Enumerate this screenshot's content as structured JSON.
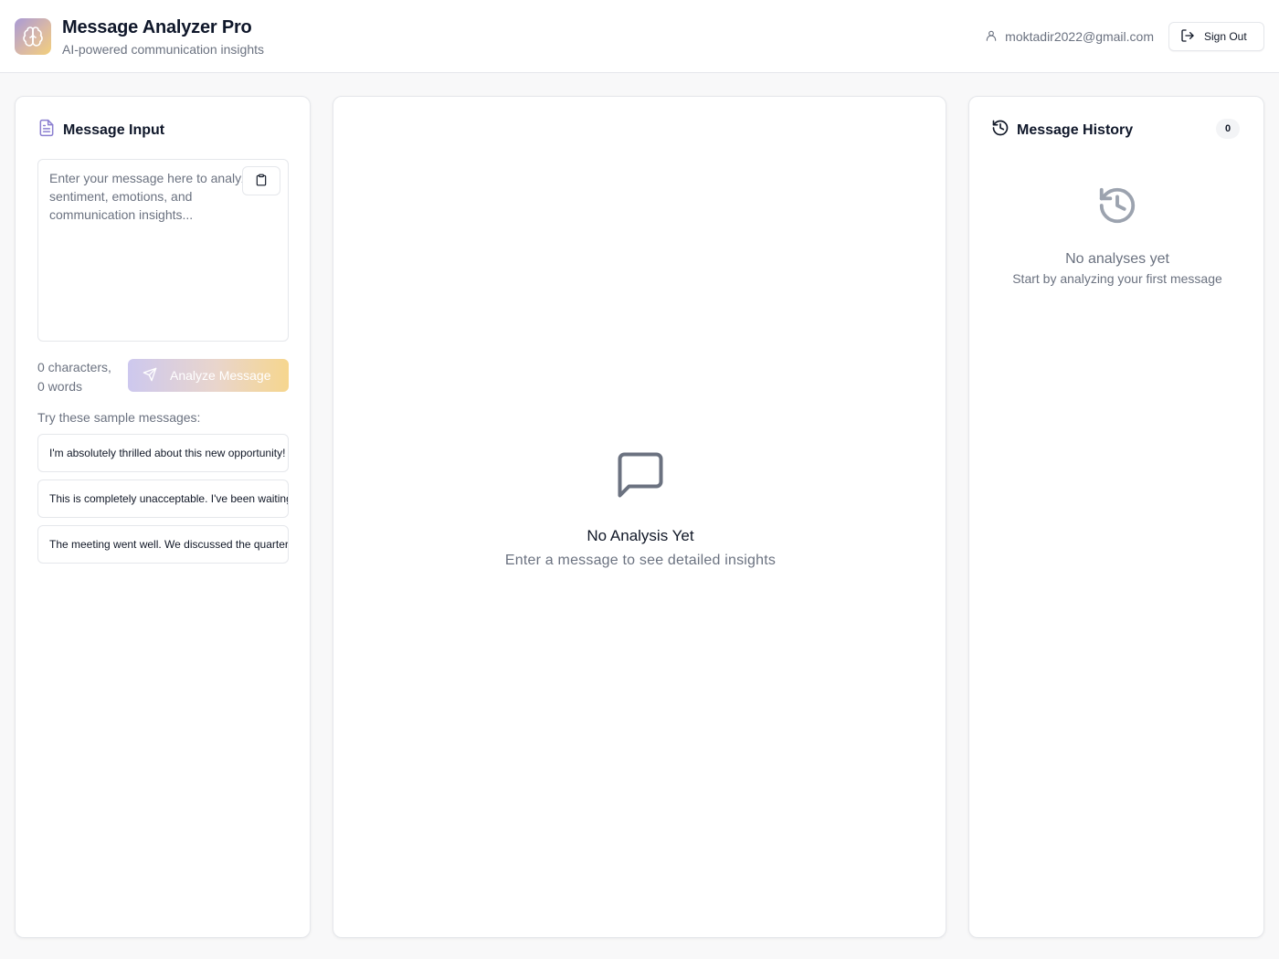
{
  "header": {
    "title": "Message Analyzer Pro",
    "subtitle": "AI-powered communication insights",
    "user_email": "moktadir2022@gmail.com",
    "sign_out_label": "Sign Out"
  },
  "input_panel": {
    "title": "Message Input",
    "placeholder": "Enter your message here to analyze sentiment, emotions, and communication insights...",
    "value": "",
    "counts_chars": "0 characters,",
    "counts_words": "0 words",
    "analyze_label": "Analyze Message",
    "samples_label": "Try these sample messages:",
    "samples": [
      "I'm absolutely thrilled about this new opportunity! The team",
      "This is completely unacceptable. I've been waiting for hours",
      "The meeting went well. We discussed the quarterly results"
    ]
  },
  "analysis_panel": {
    "empty_title": "No Analysis Yet",
    "empty_subtitle": "Enter a message to see detailed insights"
  },
  "history_panel": {
    "title": "Message History",
    "count": "0",
    "empty_title": "No analyses yet",
    "empty_subtitle": "Start by analyzing your first message"
  },
  "icons": {
    "logo": "brain-icon",
    "user": "user-icon",
    "sign_out": "log-out-icon",
    "input": "file-text-icon",
    "paste": "clipboard-icon",
    "send": "send-icon",
    "message": "message-square-icon",
    "history": "history-icon"
  },
  "colors": {
    "accent_start": "#a99ad6",
    "accent_end": "#f2cf7b",
    "muted_text": "#6b7280"
  }
}
